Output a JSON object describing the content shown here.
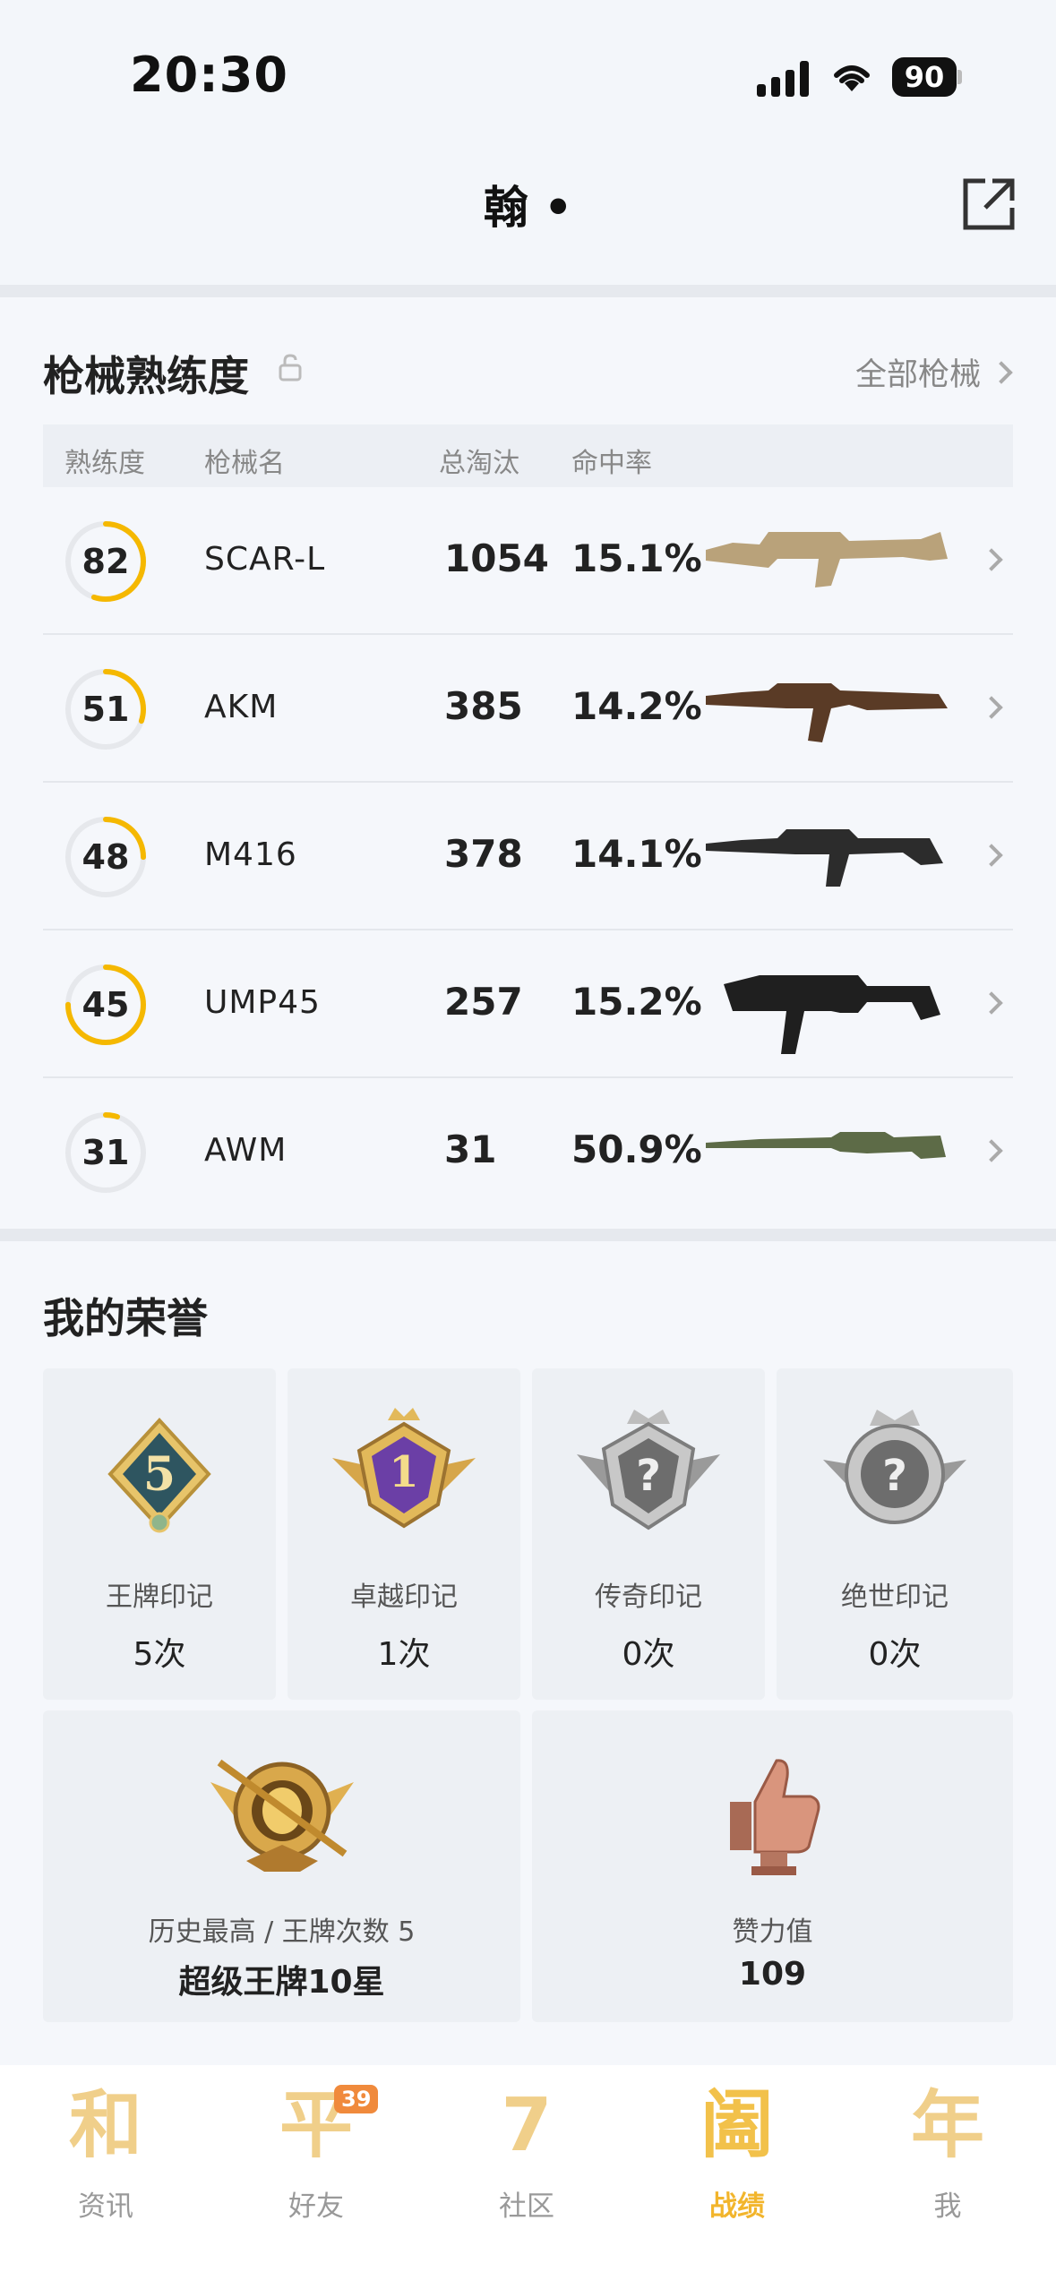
{
  "status_bar": {
    "time": "20:30",
    "battery": "90"
  },
  "header": {
    "title": "翰 •"
  },
  "weapons": {
    "title": "枪械熟练度",
    "all_link": "全部枪械",
    "columns": [
      "熟练度",
      "枪械名",
      "总淘汰",
      "命中率"
    ],
    "rows": [
      {
        "proficiency": "82",
        "progress": 0.55,
        "name": "SCAR-L",
        "kills": "1054",
        "accuracy": "15.1%",
        "gun_icon": "assault-rifle-tan"
      },
      {
        "proficiency": "51",
        "progress": 0.3,
        "name": "AKM",
        "kills": "385",
        "accuracy": "14.2%",
        "gun_icon": "assault-rifle-wood"
      },
      {
        "proficiency": "48",
        "progress": 0.25,
        "name": "M416",
        "kills": "378",
        "accuracy": "14.1%",
        "gun_icon": "assault-rifle-black"
      },
      {
        "proficiency": "45",
        "progress": 0.75,
        "name": "UMP45",
        "kills": "257",
        "accuracy": "15.2%",
        "gun_icon": "smg-black"
      },
      {
        "proficiency": "31",
        "progress": 0.05,
        "name": "AWM",
        "kills": "31",
        "accuracy": "50.9%",
        "gun_icon": "sniper-rifle-green"
      }
    ]
  },
  "honors": {
    "title": "我的荣誉",
    "marks": [
      {
        "label": "王牌印记",
        "count": "5次",
        "medal_text": "5",
        "icon": "ace-medal-icon"
      },
      {
        "label": "卓越印记",
        "count": "1次",
        "medal_text": "1",
        "icon": "excellent-medal-icon"
      },
      {
        "label": "传奇印记",
        "count": "0次",
        "medal_text": "?",
        "icon": "legend-medal-icon"
      },
      {
        "label": "绝世印记",
        "count": "0次",
        "medal_text": "?",
        "icon": "peerless-medal-icon"
      }
    ],
    "highest": {
      "label": "历史最高 / 王牌次数 5",
      "value": "超级王牌10星",
      "icon": "crown-rank-badge-icon"
    },
    "likes": {
      "label": "赞力值",
      "value": "109",
      "icon": "thumbs-up-icon"
    }
  },
  "tabbar": {
    "tabs": [
      {
        "glyph": "和",
        "label": "资讯"
      },
      {
        "glyph": "平",
        "label": "好友",
        "badge": "39"
      },
      {
        "glyph": "7",
        "label": "社区"
      },
      {
        "glyph": "阖",
        "label": "战绩",
        "active": true
      },
      {
        "glyph": "年",
        "label": "我"
      }
    ]
  },
  "colors": {
    "accent": "#f5b800",
    "ring_track": "#e6e8ec",
    "tab_active": "#f2b52c"
  }
}
